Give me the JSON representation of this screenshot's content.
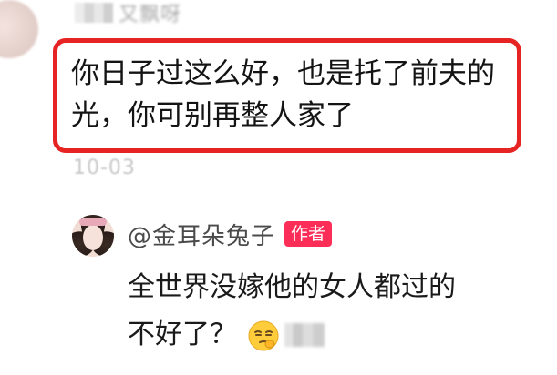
{
  "top_comment": {
    "username": "又飘呀",
    "text": "你日子过这么好，也是托了前夫的光，你可别再整人家了",
    "date": "10-03",
    "highlight_color": "#e62424"
  },
  "reply": {
    "username": "@金耳朵兔子",
    "badge": "作者",
    "badge_color": "#fc2e58",
    "text_line1": "全世界没嫁他的女人都过的",
    "text_line2": "不好了？",
    "emoji": "smirk-emoji"
  }
}
